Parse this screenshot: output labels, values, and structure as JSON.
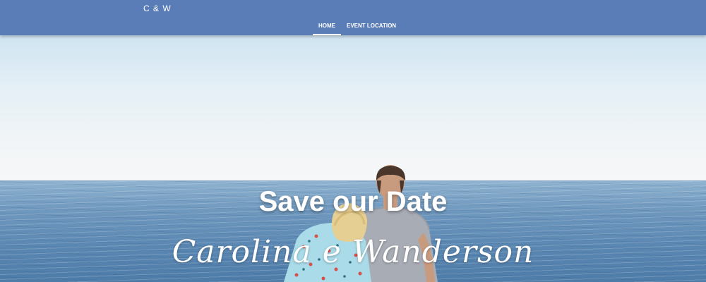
{
  "header": {
    "brand": "C & W",
    "tabs": [
      {
        "label": "HOME",
        "active": true
      },
      {
        "label": "EVENT LOCATION",
        "active": false
      }
    ]
  },
  "hero": {
    "title": "Save our Date",
    "names": "Carolina e Wanderson",
    "image": "couple-at-sea-photo"
  },
  "colors": {
    "navbar": "#5a7db8",
    "text": "#ffffff"
  }
}
